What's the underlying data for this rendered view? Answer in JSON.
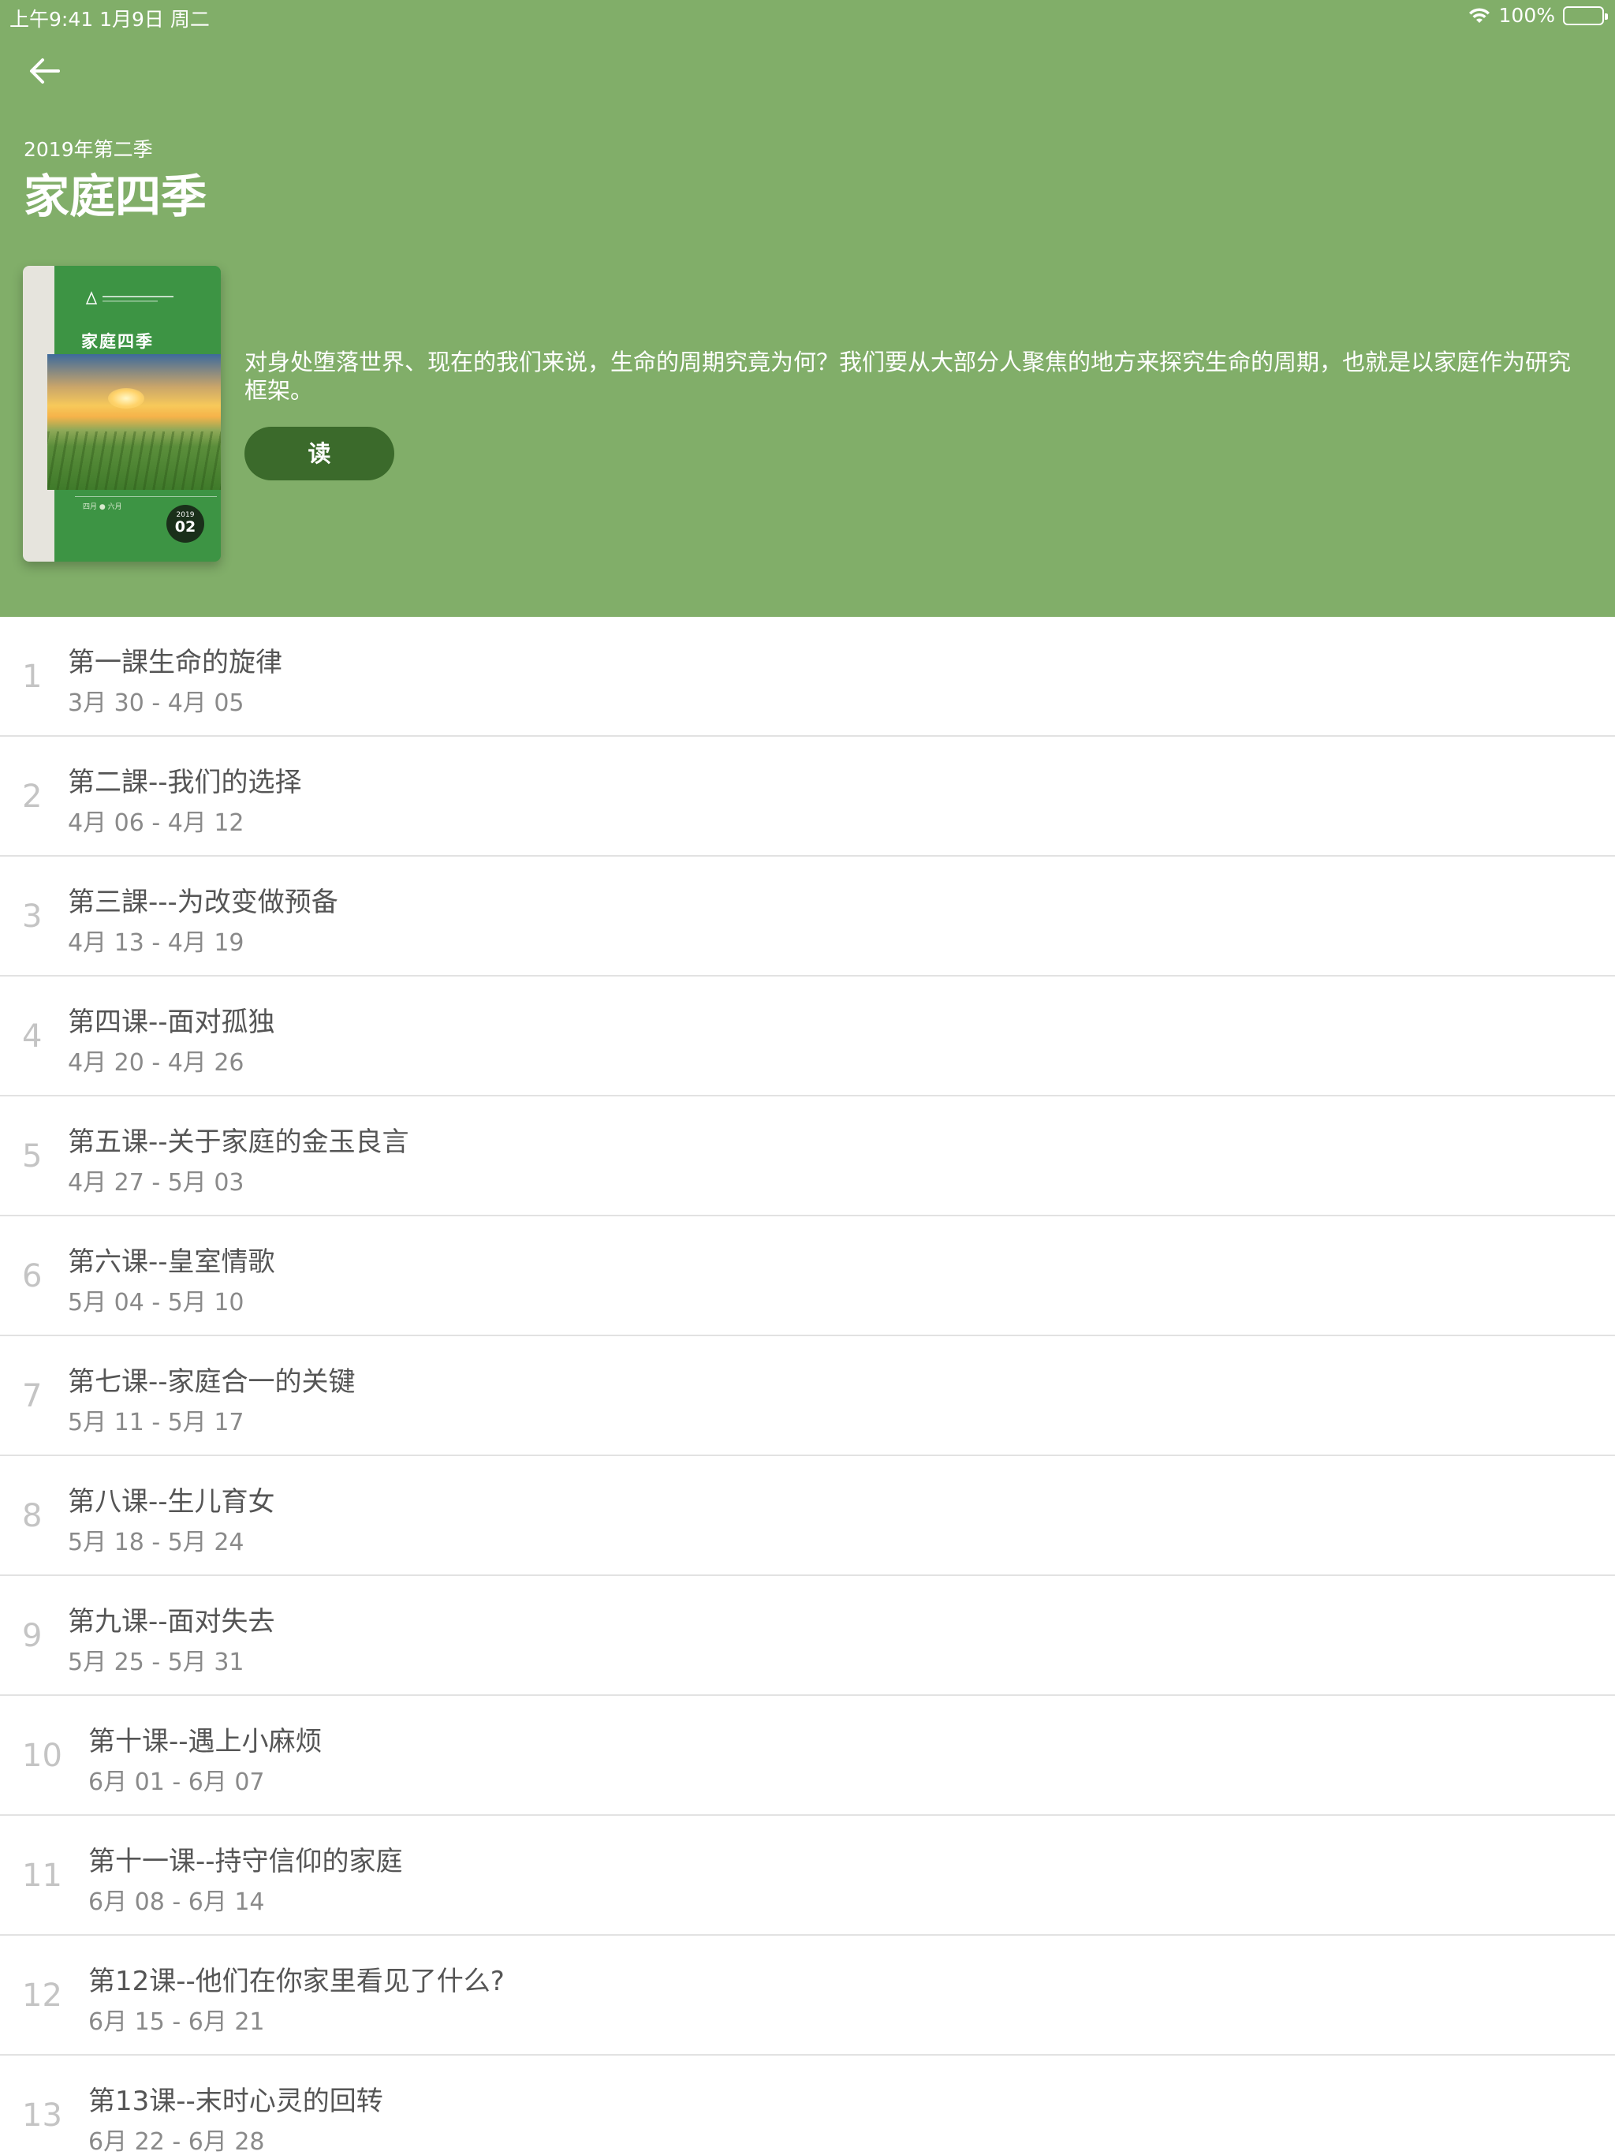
{
  "status_bar": {
    "time_date": "上午9:41   1月9日 周二",
    "battery": "100%"
  },
  "header": {
    "season": "2019年第二季",
    "title": "家庭四季",
    "description": "对身处堕落世界、现在的我们来说，生命的周期究竟为何？我们要从大部分人聚焦的地方来探究生命的周期，也就是以家庭作为研究框架。",
    "read_label": "读",
    "cover": {
      "title": "家庭四季",
      "year": "2019",
      "issue": "02",
      "small_text": "四月 ● 六月"
    }
  },
  "colors": {
    "header_bg": "#81ae69",
    "read_button": "#3b6a2b"
  },
  "lessons": [
    {
      "num": "1",
      "title": "第一課生命的旋律",
      "date": "3月 30 - 4月 05"
    },
    {
      "num": "2",
      "title": "第二課--我们的选择",
      "date": "4月 06 - 4月 12"
    },
    {
      "num": "3",
      "title": "第三課---为改变做预备",
      "date": "4月 13 - 4月 19"
    },
    {
      "num": "4",
      "title": "第四课--面对孤独",
      "date": "4月 20 - 4月 26"
    },
    {
      "num": "5",
      "title": "第五课--关于家庭的金玉良言",
      "date": "4月 27 - 5月 03"
    },
    {
      "num": "6",
      "title": "第六课--皇室情歌",
      "date": "5月 04 - 5月 10"
    },
    {
      "num": "7",
      "title": "第七课--家庭合一的关键",
      "date": "5月 11 - 5月 17"
    },
    {
      "num": "8",
      "title": "第八课--生儿育女",
      "date": "5月 18 - 5月 24"
    },
    {
      "num": "9",
      "title": "第九课--面对失去",
      "date": "5月 25 - 5月 31"
    },
    {
      "num": "10",
      "title": "第十课--遇上小麻烦",
      "date": "6月 01 - 6月 07"
    },
    {
      "num": "11",
      "title": "第十一课--持守信仰的家庭",
      "date": "6月 08 - 6月 14"
    },
    {
      "num": "12",
      "title": "第12课--他们在你家里看见了什么?",
      "date": "6月 15 - 6月 21"
    },
    {
      "num": "13",
      "title": "第13课--末时心灵的回转",
      "date": "6月 22 - 6月 28"
    }
  ]
}
